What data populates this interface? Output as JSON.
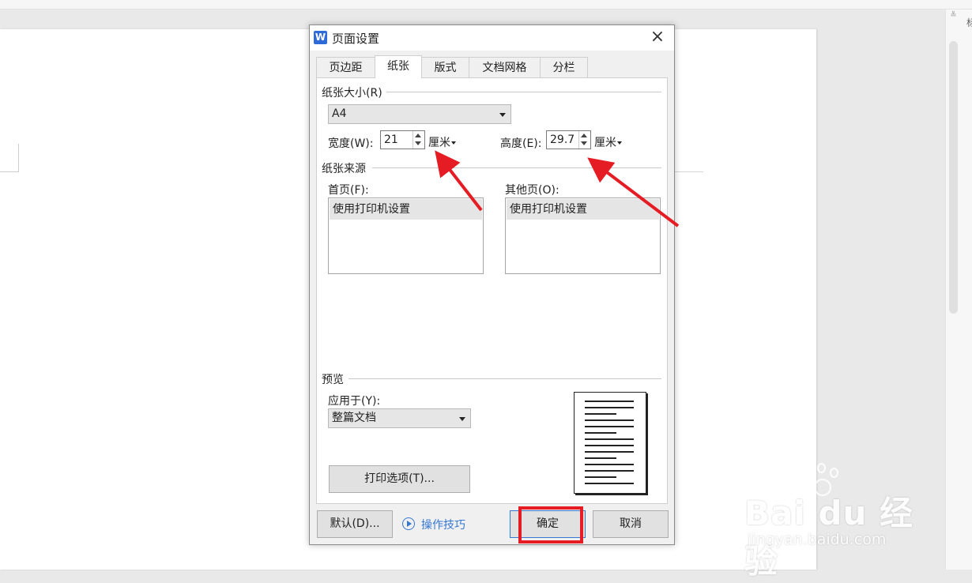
{
  "dialog": {
    "title": "页面设置",
    "app_icon": "W",
    "close_icon": "×",
    "tabs": [
      {
        "label": "页边距"
      },
      {
        "label": "纸张",
        "active": true
      },
      {
        "label": "版式"
      },
      {
        "label": "文档网格"
      },
      {
        "label": "分栏"
      }
    ],
    "paper_size": {
      "group_label": "纸张大小(R)",
      "selected": "A4",
      "width_label": "宽度(W):",
      "width_value": "21",
      "width_unit": "厘米",
      "height_label": "高度(E):",
      "height_value": "29.7",
      "height_unit": "厘米"
    },
    "paper_source": {
      "group_label": "纸张来源",
      "first_page_label": "首页(F):",
      "first_page_item": "使用打印机设置",
      "other_pages_label": "其他页(O):",
      "other_pages_item": "使用打印机设置"
    },
    "preview": {
      "group_label": "预览",
      "apply_label": "应用于(Y):",
      "apply_selected": "整篇文档",
      "print_options_button": "打印选项(T)..."
    },
    "footer": {
      "default_button": "默认(D)...",
      "tips_link": "操作技巧",
      "ok_button": "确定",
      "cancel_button": "取消"
    }
  },
  "sidebar": {
    "partial_char": "标"
  },
  "watermark": {
    "brand": "Bai du 经验",
    "url": "jingyan.baidu.com"
  },
  "colors": {
    "annotation_red": "#e51c23",
    "link_blue": "#3578d4",
    "app_icon_blue": "#2f6bd8"
  }
}
